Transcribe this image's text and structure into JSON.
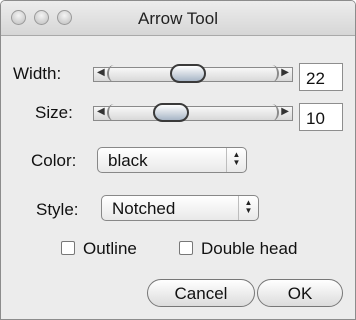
{
  "window": {
    "title": "Arrow Tool"
  },
  "width_control": {
    "label": "Width:",
    "value": "22",
    "level_fraction": 0.45
  },
  "size_control": {
    "label": "Size:",
    "value": "10",
    "level_fraction": 0.3
  },
  "color_control": {
    "label": "Color:",
    "selected": "black"
  },
  "style_control": {
    "label": "Style:",
    "selected": "Notched"
  },
  "options": {
    "outline_label": "Outline",
    "outline_checked": false,
    "double_head_label": "Double head",
    "double_head_checked": false
  },
  "buttons": {
    "cancel_label": "Cancel",
    "ok_label": "OK"
  }
}
